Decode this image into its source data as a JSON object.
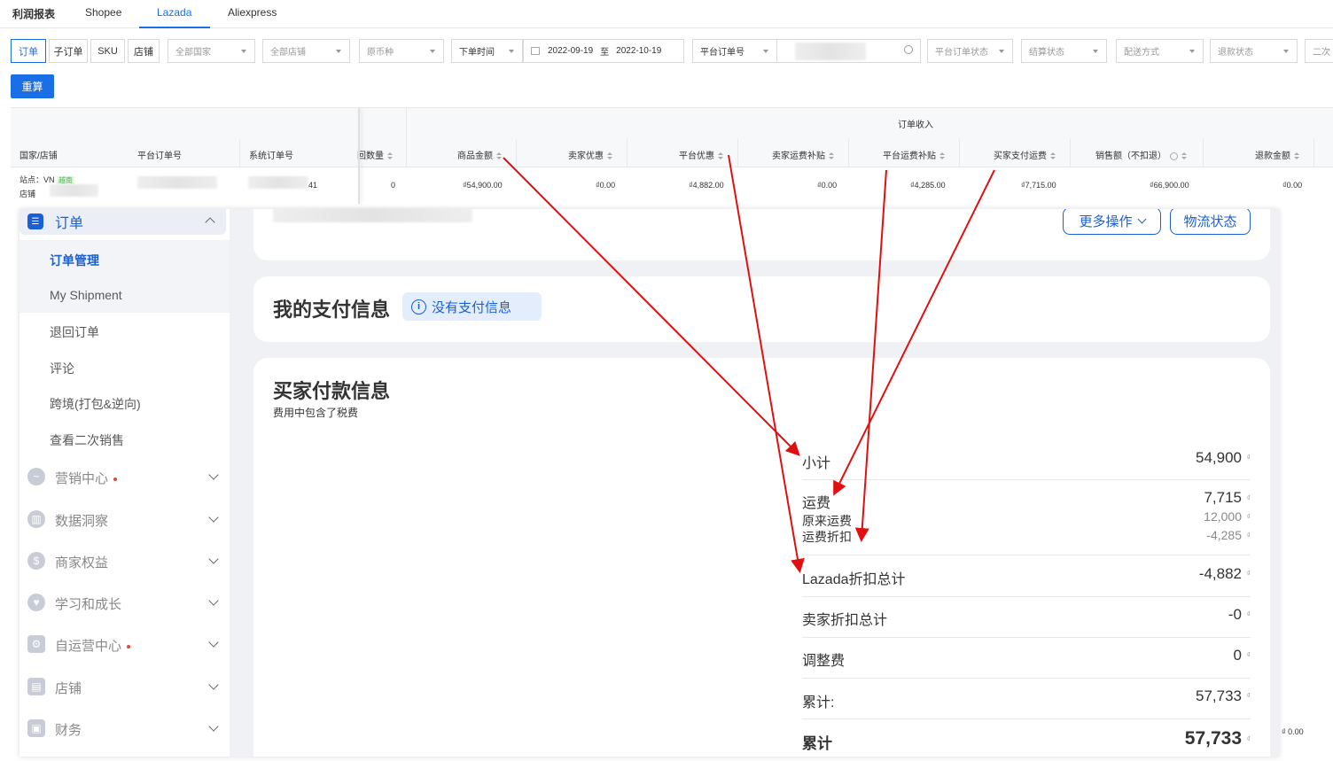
{
  "tabs": {
    "title": "利润报表",
    "shopee": "Shopee",
    "lazada": "Lazada",
    "aliexpress": "Aliexpress"
  },
  "filters": {
    "seg_order": "订单",
    "seg_suborder": "子订单",
    "seg_sku": "SKU",
    "seg_store": "店铺",
    "all_countries": "全部国家",
    "all_stores": "全部店铺",
    "currency": "原币种",
    "time_type": "下单时间",
    "date_from": "2022-09-19",
    "date_to_sep": "至",
    "date_to": "2022-10-19",
    "order_no_type": "平台订单号",
    "platform_status": "平台订单状态",
    "settle_status": "结算状态",
    "ship_method": "配送方式",
    "refund_status": "退款状态",
    "second_sale": "二次"
  },
  "recalc_label": "重算",
  "table": {
    "group_header": "订单收入",
    "headers": {
      "country_store": "国家/店铺",
      "platform_order": "平台订单号",
      "system_order": "系统订单号",
      "return_qty": "回数量",
      "goods_amount": "商品金额",
      "seller_discount": "卖家优惠",
      "platform_discount": "平台优惠",
      "seller_ship_subsidy": "卖家运费补贴",
      "platform_ship_subsidy": "平台运费补贴",
      "buyer_ship_fee": "买家支付运费",
      "sales_no_refund": "销售额（不扣退）",
      "refund_amount": "退款金额"
    },
    "row": {
      "site": "站点：VN",
      "site_tag": "越南",
      "store": "店铺",
      "sys_order_tail": "41",
      "return_qty": "0",
      "goods_amount": "₫54,900.00",
      "seller_discount": "₫0.00",
      "platform_discount": "₫4,882.00",
      "seller_ship_subsidy": "₫0.00",
      "platform_ship_subsidy": "₫4,285.00",
      "buyer_ship_fee": "₫7,715.00",
      "sales_no_refund": "₫66,900.00",
      "refund_amount": "₫0.00"
    },
    "bottom_value": "₫ 0.00"
  },
  "lazada": {
    "sidebar": {
      "orders_group": "订单",
      "items": [
        "订单管理",
        "My Shipment",
        "退回订单",
        "评论",
        "跨境(打包&逆向)",
        "查看二次销售"
      ],
      "groups": [
        "营销中心",
        "数据洞察",
        "商家权益",
        "学习和成长",
        "自运营中心",
        "店铺",
        "财务"
      ]
    },
    "more_actions": "更多操作",
    "logistics_status": "物流状态",
    "my_payment_title": "我的支付信息",
    "no_payment_info": "没有支付信息",
    "buyer_payment_title": "买家付款信息",
    "fee_note": "费用中包含了税费",
    "currency_symbol": "₫",
    "rows": {
      "subtotal_label": "小计",
      "subtotal_value": "54,900",
      "shipping_label": "运费",
      "shipping_value": "7,715",
      "original_ship_label": "原来运费",
      "original_ship_value": "12,000",
      "ship_discount_label": "运费折扣",
      "ship_discount_value": "-4,285",
      "lazada_discount_label": "Lazada折扣总计",
      "lazada_discount_value": "-4,882",
      "seller_discount_label": "卖家折扣总计",
      "seller_discount_value": "-0",
      "adjust_label": "调整费",
      "adjust_value": "0",
      "total_label": "累计:",
      "total_value": "57,733",
      "grand_total_label": "累计",
      "grand_total_value": "57,733"
    }
  },
  "colors": {
    "accent": "#1a6fe6",
    "lazada_blue": "#1a5fd6",
    "arrow": "#e01010"
  }
}
